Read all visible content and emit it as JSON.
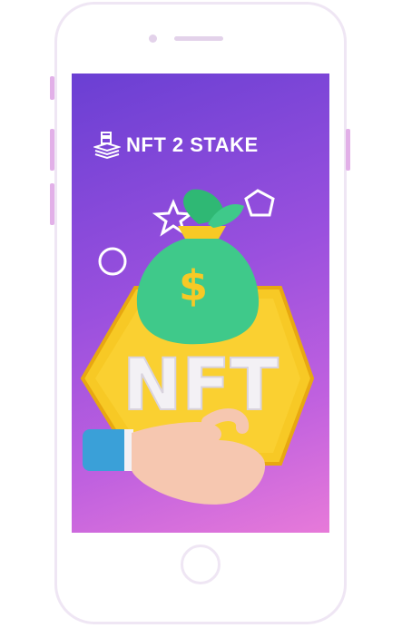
{
  "brand": {
    "logo_icon": "stacked-layers-icon",
    "name": "NFT 2 STAKE"
  },
  "hero": {
    "badge_text": "NFT",
    "bag_symbol": "$",
    "colors": {
      "gradient_top": "#6a3fd3",
      "gradient_bottom": "#e77ad9",
      "coin": "#f7c925",
      "bag": "#3fc98a",
      "sleeve": "#3aa0d8"
    }
  }
}
